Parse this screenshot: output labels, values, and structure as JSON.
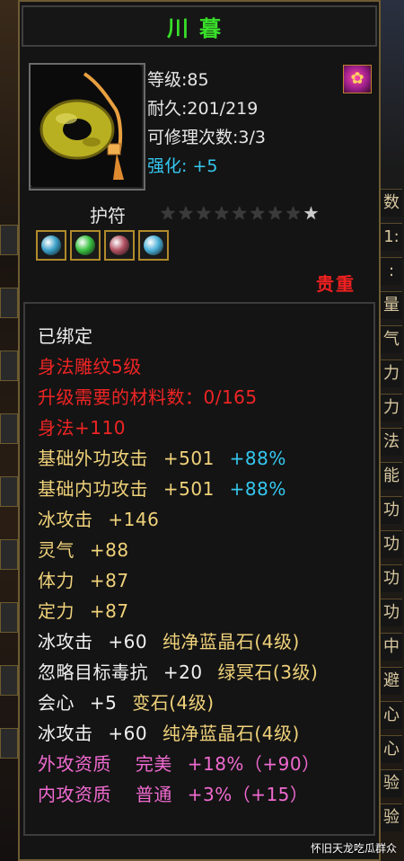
{
  "item": {
    "name": "川暮",
    "level": "等级:85",
    "durability": "耐久:201/219",
    "repair_count": "可修理次数:3/3",
    "enhance_label": "强化:",
    "enhance_value": "+5"
  },
  "amulet": {
    "label": "护符",
    "stars_total": 9,
    "stars_lit": 1
  },
  "gem_colors": [
    "#3aa0c8",
    "#38c040",
    "#b05060",
    "#4ab0d8"
  ],
  "rarity": "贵重",
  "attributes": {
    "bound": "已绑定",
    "agility_carve": "身法雕纹5级",
    "upgrade_material": "升级需要的材料数：0/165",
    "agility": "身法+110",
    "outer_attack": "基础外功攻击",
    "outer_attack_val": "+501",
    "outer_attack_pct": "+88%",
    "inner_attack": "基础内功攻击",
    "inner_attack_val": "+501",
    "inner_attack_pct": "+88%",
    "ice_attack": "冰攻击",
    "ice_attack_val": "+146",
    "spirit": "灵气",
    "spirit_val": "+88",
    "stamina": "体力",
    "stamina_val": "+87",
    "focus": "定力",
    "focus_val": "+87",
    "gem1_attr": "冰攻击",
    "gem1_val": "+60",
    "gem1_name": "纯净蓝晶石(4级)",
    "gem2_attr": "忽略目标毒抗",
    "gem2_val": "+20",
    "gem2_name": "绿冥石(3级)",
    "gem3_attr": "会心",
    "gem3_val": "+5",
    "gem3_name": "变石(4级)",
    "gem4_attr": "冰攻击",
    "gem4_val": "+60",
    "gem4_name": "纯净蓝晶石(4级)",
    "outer_quality": "外攻资质",
    "outer_quality_grade": "完美",
    "outer_quality_val": "+18%（+90）",
    "inner_quality": "内攻资质",
    "inner_quality_grade": "普通",
    "inner_quality_val": "+3%（+15）"
  },
  "right_edge_chars": [
    "数",
    "1:",
    ":",
    "量",
    "气",
    "力",
    "力",
    "法",
    "能",
    "功",
    "功",
    "功",
    "功",
    "中",
    "避",
    "心",
    "心",
    "验",
    "验"
  ],
  "watermark": "怀旧天龙吃瓜群众"
}
